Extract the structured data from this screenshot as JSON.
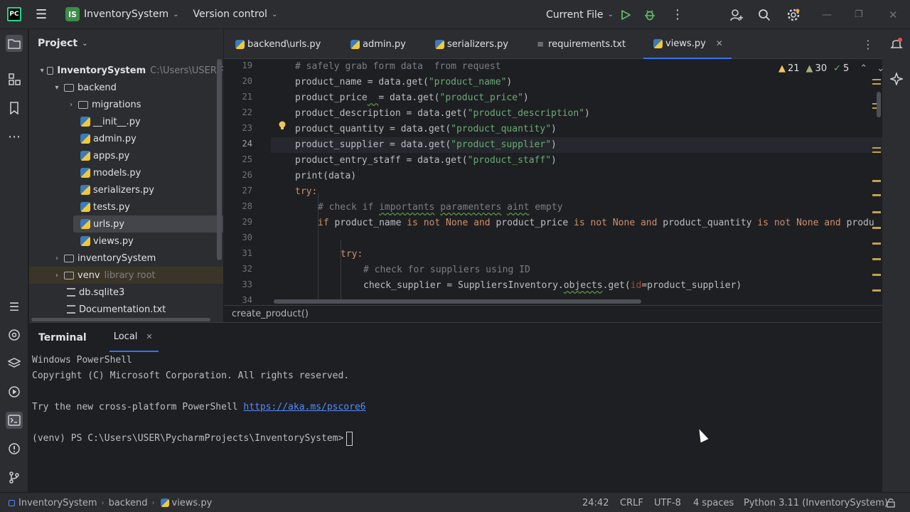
{
  "titlebar": {
    "logo": "PC",
    "project_badge": "IS",
    "project_name": "InventorySystem",
    "vcs": "Version control",
    "run_config": "Current File"
  },
  "project_panel": {
    "title": "Project",
    "root": {
      "name": "InventorySystem",
      "path": "C:\\Users\\USER\\P"
    },
    "items": [
      {
        "label": "backend",
        "type": "folder"
      },
      {
        "label": "migrations",
        "type": "folder"
      },
      {
        "label": "__init__.py",
        "type": "py"
      },
      {
        "label": "admin.py",
        "type": "py"
      },
      {
        "label": "apps.py",
        "type": "py"
      },
      {
        "label": "models.py",
        "type": "py"
      },
      {
        "label": "serializers.py",
        "type": "py"
      },
      {
        "label": "tests.py",
        "type": "py"
      },
      {
        "label": "urls.py",
        "type": "py"
      },
      {
        "label": "views.py",
        "type": "py"
      },
      {
        "label": "inventorySystem",
        "type": "folder"
      },
      {
        "label": "venv",
        "type": "folder",
        "note": "library root"
      },
      {
        "label": "db.sqlite3",
        "type": "db"
      },
      {
        "label": "Documentation.txt",
        "type": "txt"
      }
    ]
  },
  "tabs": [
    {
      "label": "backend\\urls.py"
    },
    {
      "label": "admin.py"
    },
    {
      "label": "serializers.py"
    },
    {
      "label": "requirements.txt"
    },
    {
      "label": "views.py"
    }
  ],
  "inspections": {
    "warnings": "21",
    "weak_warnings": "30",
    "ok": "5"
  },
  "code": {
    "line_numbers": [
      "19",
      "20",
      "21",
      "22",
      "23",
      "24",
      "25",
      "26",
      "27",
      "28",
      "29",
      "30",
      "31",
      "32",
      "33",
      "34"
    ],
    "current_line": "24",
    "lines": {
      "l19": "# safely grab form data  from request",
      "l20a": "product_name = data.get(",
      "l20s": "\"product_name\"",
      "l20b": ")",
      "l21a": "product_price",
      "l21u": "  ",
      "l21b": "= data.get(",
      "l21s": "\"product_price\"",
      "l21c": ")",
      "l22a": "product_description = data.get(",
      "l22s": "\"product_description\"",
      "l22b": ")",
      "l23a": "product_quantity = data.get(",
      "l23s": "\"product_quantity\"",
      "l23b": ")",
      "l24a": "product_supplier = data.get(",
      "l24s": "\"product_supplier\"",
      "l24b": ")",
      "l25a": "product_entry_staff = data.get(",
      "l25s": "\"product_staff\"",
      "l25b": ")",
      "l26a": "print",
      "l26b": "(data)",
      "l27": "try:",
      "l28a": "# check if ",
      "l28b": "importants",
      "l28c": " ",
      "l28d": "paramenters",
      "l28e": " ",
      "l28f": "aint",
      "l28g": " empty",
      "l29_if": "if",
      "l29a": " product_name ",
      "l29is1": "is not None and",
      "l29b": " product_price ",
      "l29is2": "is not None and",
      "l29c": " product_quantity ",
      "l29is3": "is not None and",
      "l29d": " produ",
      "l31": "try:",
      "l32": "# check for suppliers using ID",
      "l33a": "check_supplier = SuppliersInventory.",
      "l33b": "objects",
      "l33c": ".get(",
      "l33p": "id",
      "l33d": "=product_supplier)"
    }
  },
  "breadcrumb_function": "create_product()",
  "terminal": {
    "title": "Terminal",
    "tab": "Local",
    "lines": {
      "t1": "Windows PowerShell",
      "t2": "Copyright (C) Microsoft Corporation. All rights reserved.",
      "t3a": "Try the new cross-platform PowerShell ",
      "t3link": "https://aka.ms/pscore6",
      "t4": "(venv) PS C:\\Users\\USER\\PycharmProjects\\InventorySystem>"
    }
  },
  "statusbar": {
    "crumbs": [
      "InventorySystem",
      "backend",
      "views.py"
    ],
    "position": "24:42",
    "line_sep": "CRLF",
    "encoding": "UTF-8",
    "indent": "4 spaces",
    "interpreter": "Python 3.11 (InventorySystem)"
  }
}
